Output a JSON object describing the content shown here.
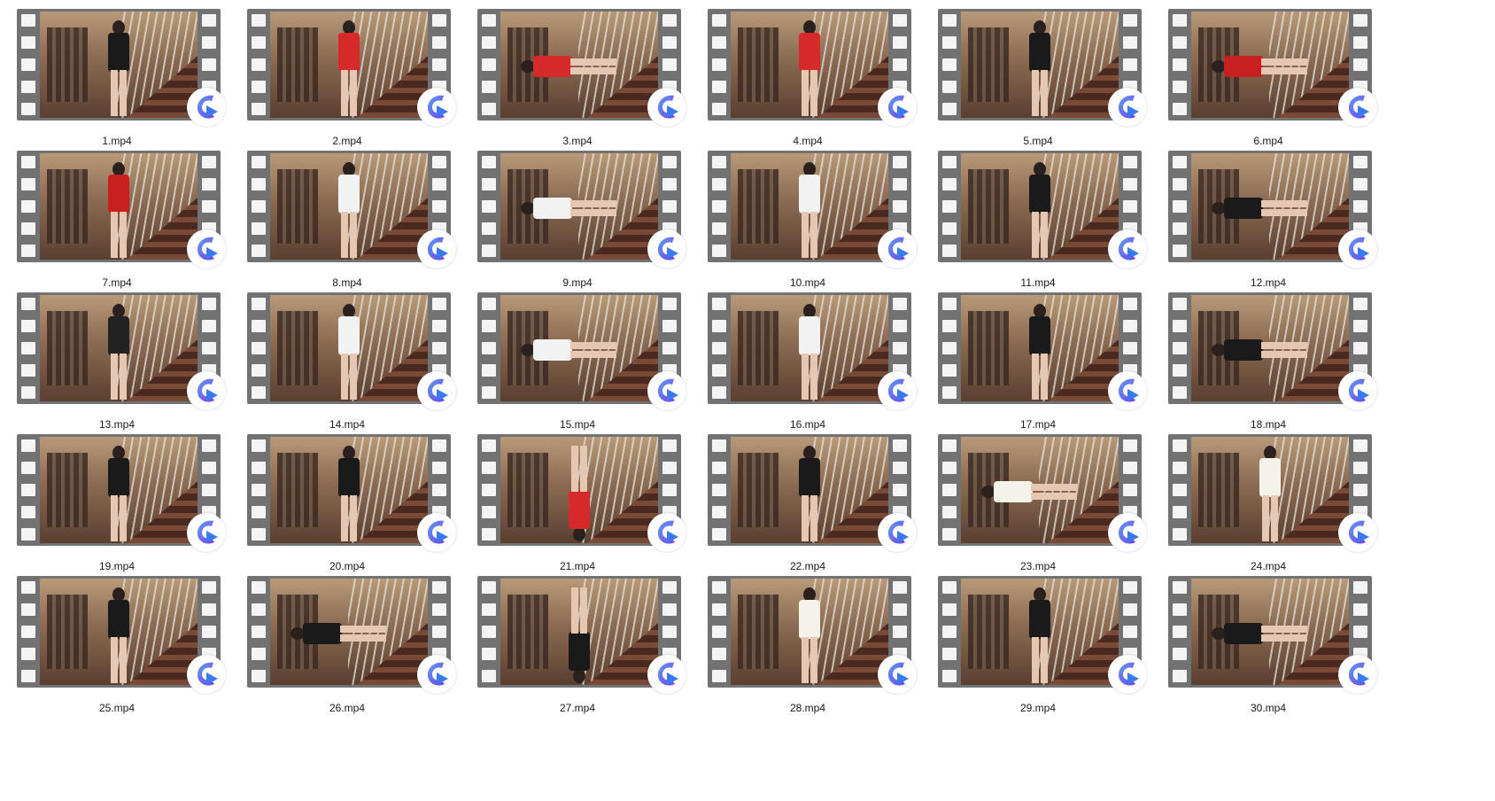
{
  "explorer": {
    "view": "large-icons",
    "files": [
      {
        "name": "1.mp4",
        "top_color": "#1a1a1a",
        "orientation": "upright"
      },
      {
        "name": "2.mp4",
        "top_color": "#d42a2a",
        "orientation": "upright"
      },
      {
        "name": "3.mp4",
        "top_color": "#d42a2a",
        "orientation": "rotated-left"
      },
      {
        "name": "4.mp4",
        "top_color": "#d42a2a",
        "orientation": "upright"
      },
      {
        "name": "5.mp4",
        "top_color": "#1a1a1a",
        "orientation": "upright"
      },
      {
        "name": "6.mp4",
        "top_color": "#c8201e",
        "orientation": "rotated-left"
      },
      {
        "name": "7.mp4",
        "top_color": "#c8201e",
        "orientation": "upright"
      },
      {
        "name": "8.mp4",
        "top_color": "#f2f2f2",
        "orientation": "upright"
      },
      {
        "name": "9.mp4",
        "top_color": "#f2f2f2",
        "orientation": "rotated-left"
      },
      {
        "name": "10.mp4",
        "top_color": "#f2f2f2",
        "orientation": "upright"
      },
      {
        "name": "11.mp4",
        "top_color": "#1a1a1a",
        "orientation": "upright"
      },
      {
        "name": "12.mp4",
        "top_color": "#1a1a1a",
        "orientation": "rotated-left"
      },
      {
        "name": "13.mp4",
        "top_color": "#222222",
        "orientation": "upright"
      },
      {
        "name": "14.mp4",
        "top_color": "#f2f2f2",
        "orientation": "upright"
      },
      {
        "name": "15.mp4",
        "top_color": "#f2f2f2",
        "orientation": "rotated-left"
      },
      {
        "name": "16.mp4",
        "top_color": "#f2f2f2",
        "orientation": "upright"
      },
      {
        "name": "17.mp4",
        "top_color": "#1a1a1a",
        "orientation": "upright"
      },
      {
        "name": "18.mp4",
        "top_color": "#1a1a1a",
        "orientation": "rotated-left"
      },
      {
        "name": "19.mp4",
        "top_color": "#1a1a1a",
        "orientation": "upright"
      },
      {
        "name": "20.mp4",
        "top_color": "#1a1a1a",
        "orientation": "upright"
      },
      {
        "name": "21.mp4",
        "top_color": "#d42a2a",
        "orientation": "upside-down"
      },
      {
        "name": "22.mp4",
        "top_color": "#1a1a1a",
        "orientation": "upright"
      },
      {
        "name": "23.mp4",
        "top_color": "#f5f2ea",
        "orientation": "rotated-left"
      },
      {
        "name": "24.mp4",
        "top_color": "#f5f2ea",
        "orientation": "upright"
      },
      {
        "name": "25.mp4",
        "top_color": "#1a1a1a",
        "orientation": "upright"
      },
      {
        "name": "26.mp4",
        "top_color": "#1a1a1a",
        "orientation": "rotated-left"
      },
      {
        "name": "27.mp4",
        "top_color": "#1a1a1a",
        "orientation": "upside-down"
      },
      {
        "name": "28.mp4",
        "top_color": "#f5f2ea",
        "orientation": "upright"
      },
      {
        "name": "29.mp4",
        "top_color": "#1a1a1a",
        "orientation": "upright"
      },
      {
        "name": "30.mp4",
        "top_color": "#1a1a1a",
        "orientation": "rotated-left"
      }
    ],
    "default_app_icon": "media-player-icon",
    "colors": {
      "film_strip": "#727272",
      "sprocket": "#f4f4f4",
      "player_gradient_start": "#5aa0f5",
      "player_gradient_end": "#7a3be8"
    }
  }
}
